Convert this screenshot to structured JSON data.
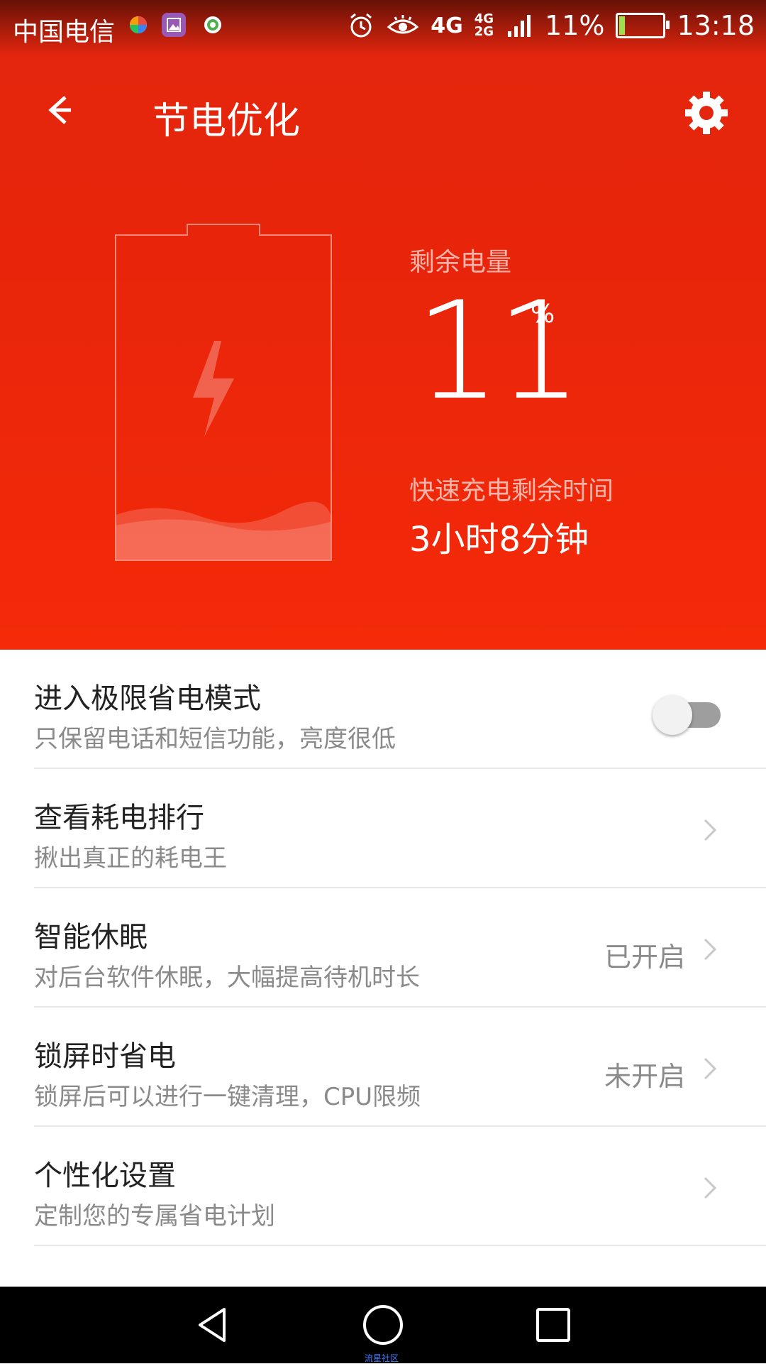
{
  "status_bar": {
    "carrier": "中国电信",
    "network_top": "4G",
    "network_stack_top": "4G",
    "network_stack_bottom": "2G",
    "battery_percent": "11%",
    "time": "13:18"
  },
  "app_bar": {
    "title": "节电优化"
  },
  "hero": {
    "remaining_label": "剩余电量",
    "battery_value": "11",
    "battery_unit": "%",
    "charge_label": "快速充电剩余时间",
    "charge_time": "3小时8分钟",
    "battery_level": 0.11
  },
  "settings": [
    {
      "title": "进入极限省电模式",
      "subtitle": "只保留电话和短信功能，亮度很低",
      "toggle_on": false
    },
    {
      "title": "查看耗电排行",
      "subtitle": "揪出真正的耗电王"
    },
    {
      "title": "智能休眠",
      "subtitle": "对后台软件休眠，大幅提高待机时长",
      "status": "已开启"
    },
    {
      "title": "锁屏时省电",
      "subtitle": "锁屏后可以进行一键清理，CPU限频",
      "status": "未开启"
    },
    {
      "title": "个性化设置",
      "subtitle": "定制您的专属省电计划"
    }
  ],
  "watermark": "流星社区",
  "colors": {
    "accent": "#e8250a",
    "text_primary": "#222222",
    "text_secondary": "#8a8a8a"
  }
}
